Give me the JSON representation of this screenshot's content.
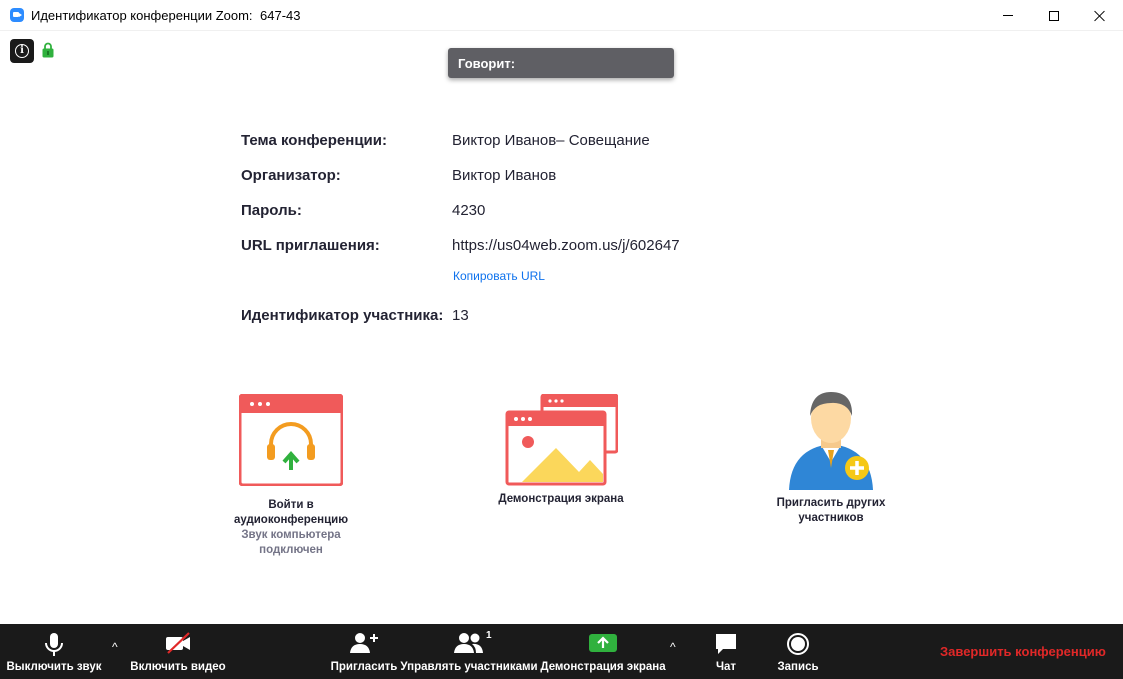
{
  "window": {
    "title": "Идентификатор конференции Zoom:",
    "meeting_id": "647-43"
  },
  "speaking_banner": "Говорит:",
  "meeting_info": {
    "topic_label": "Тема конференции:",
    "topic_value": "Виктор Иванов– Совещание",
    "host_label": "Организатор:",
    "host_value": "Виктор Иванов",
    "password_label": "Пароль:",
    "password_value": "4230",
    "url_label": "URL приглашения:",
    "url_value": "https://us04web.zoom.us/j/602647",
    "copy_url": "Копировать URL",
    "participant_id_label": "Идентификатор участника:",
    "participant_id_value": "13"
  },
  "tiles": {
    "audio_line1": "Войти в",
    "audio_line2": "аудиоконференцию",
    "audio_sub1": "Звук компьютера",
    "audio_sub2": "подключен",
    "share": "Демонстрация экрана",
    "invite_line1": "Пригласить других",
    "invite_line2": "участников"
  },
  "toolbar": {
    "mute": "Выключить звук",
    "video": "Включить видео",
    "invite": "Пригласить",
    "participants": "Управлять участниками",
    "participants_count": "1",
    "share": "Демонстрация экрана",
    "chat": "Чат",
    "record": "Запись",
    "end": "Завершить конференцию"
  },
  "colors": {
    "accent_blue": "#0e72ed",
    "tile_red": "#f05a5a",
    "share_green": "#30b13e",
    "end_red": "#e02828",
    "toolbar_bg": "#1a1a1a"
  },
  "icons": [
    "zoom-app-icon",
    "info-icon",
    "lock-icon",
    "headphones-icon",
    "screen-share-icon",
    "invite-person-icon",
    "microphone-icon",
    "video-off-icon",
    "add-person-icon",
    "participants-icon",
    "share-arrow-icon",
    "chat-icon",
    "record-icon"
  ]
}
